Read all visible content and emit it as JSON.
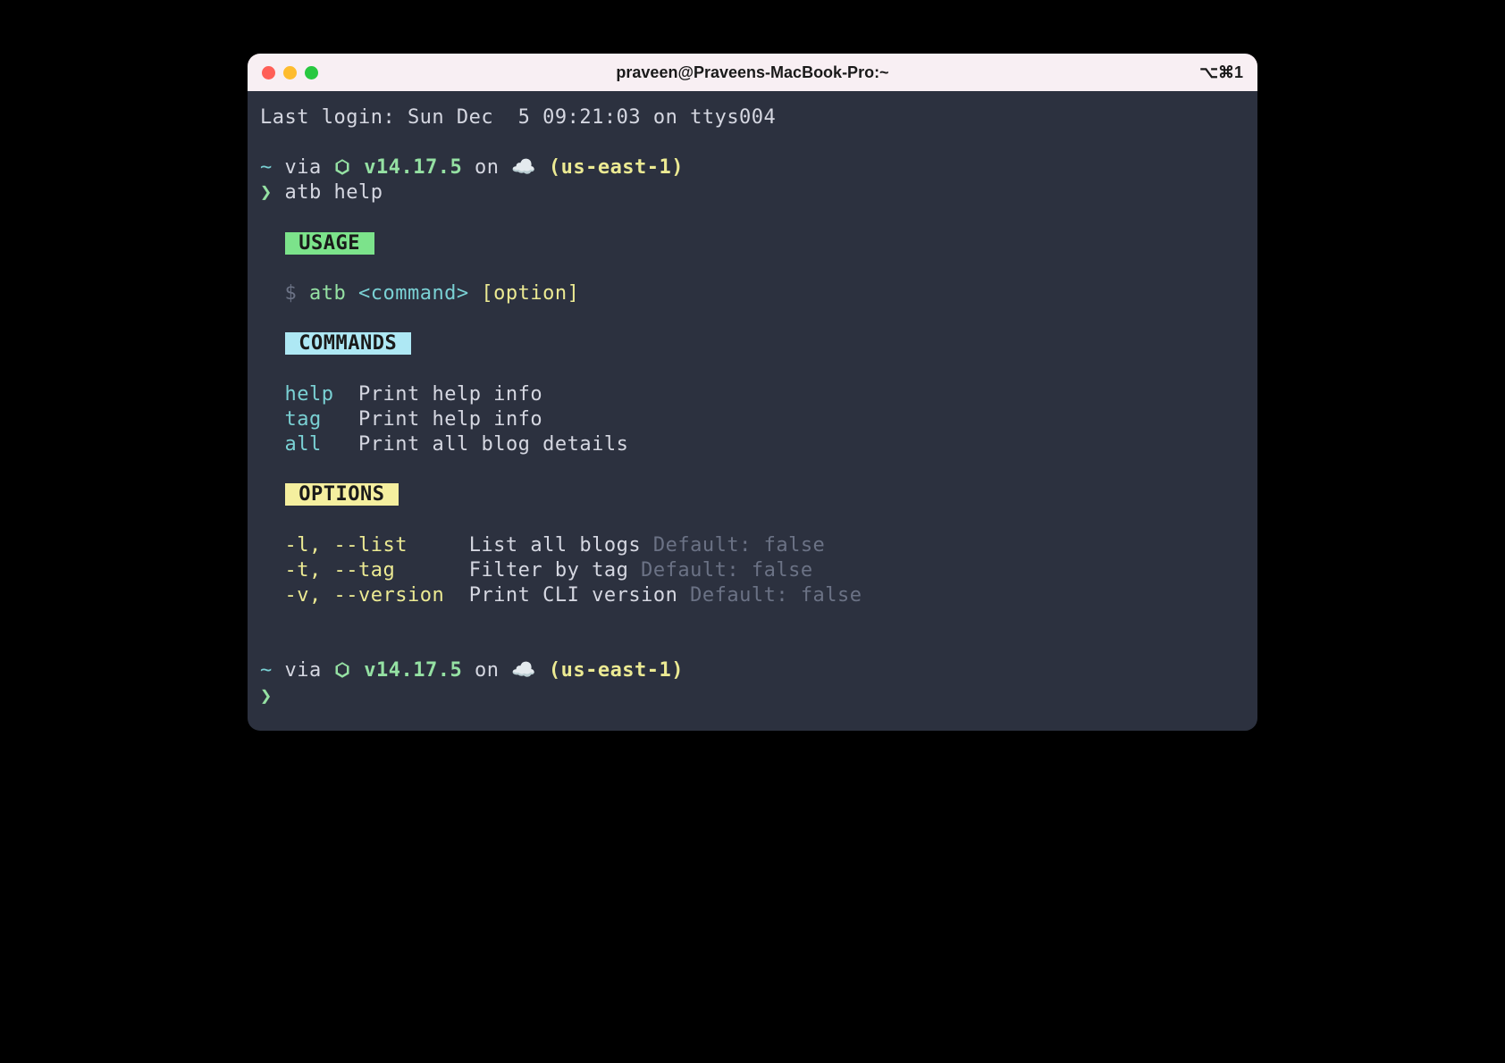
{
  "titlebar": {
    "title": "praveen@Praveens-MacBook-Pro:~",
    "shortcut": "⌥⌘1"
  },
  "last_login": "Last login: Sun Dec  5 09:21:03 on ttys004",
  "prompt": {
    "tilde": "~",
    "via": " via ",
    "node_version": "v14.17.5",
    "on": " on ",
    "cloud": "☁️",
    "region": " (us-east-1)",
    "arrow": "❯ "
  },
  "command": "atb help",
  "sections": {
    "usage": {
      "label": " USAGE ",
      "dollar": "  $ ",
      "cmd": "atb ",
      "args": "<command> ",
      "opts": "[option]"
    },
    "commands": {
      "label": " COMMANDS ",
      "items": [
        {
          "name": "help",
          "pad": "  ",
          "desc": "Print help info"
        },
        {
          "name": "tag",
          "pad": "   ",
          "desc": "Print help info"
        },
        {
          "name": "all",
          "pad": "   ",
          "desc": "Print all blog details"
        }
      ]
    },
    "options": {
      "label": " OPTIONS ",
      "items": [
        {
          "flags": "-l, --list",
          "pad": "     ",
          "desc": "List all blogs ",
          "default": "Default: false"
        },
        {
          "flags": "-t, --tag",
          "pad": "      ",
          "desc": "Filter by tag ",
          "default": "Default: false"
        },
        {
          "flags": "-v, --version",
          "pad": "  ",
          "desc": "Print CLI version ",
          "default": "Default: false"
        }
      ]
    }
  }
}
